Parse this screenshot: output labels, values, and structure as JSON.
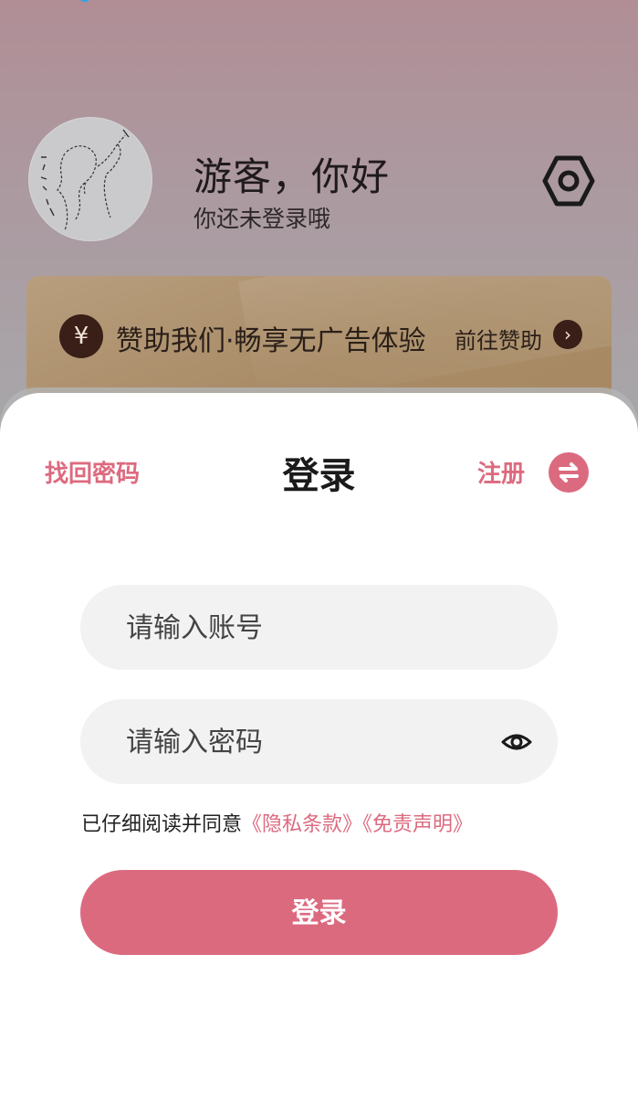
{
  "profile": {
    "greeting": "游客，你好",
    "subtitle": "你还未登录哦",
    "avatar_icon": "avatar-sketch",
    "settings_icon": "hexagon-settings-icon"
  },
  "sponsor": {
    "icon": "¥",
    "text": "赞助我们·畅享无广告体验",
    "action": "前往赞助",
    "arrow": "›"
  },
  "login": {
    "find_password": "找回密码",
    "title": "登录",
    "register": "注册",
    "account_placeholder": "请输入账号",
    "password_placeholder": "请输入密码",
    "agree_prefix": "已仔细阅读并同意",
    "privacy_link": "《隐私条款》",
    "disclaimer_link": "《免责声明》",
    "submit": "登录"
  },
  "colors": {
    "accent": "#dc6a7f",
    "sponsor_bg": "#a98c67",
    "icon_dark": "#3a1f18"
  }
}
